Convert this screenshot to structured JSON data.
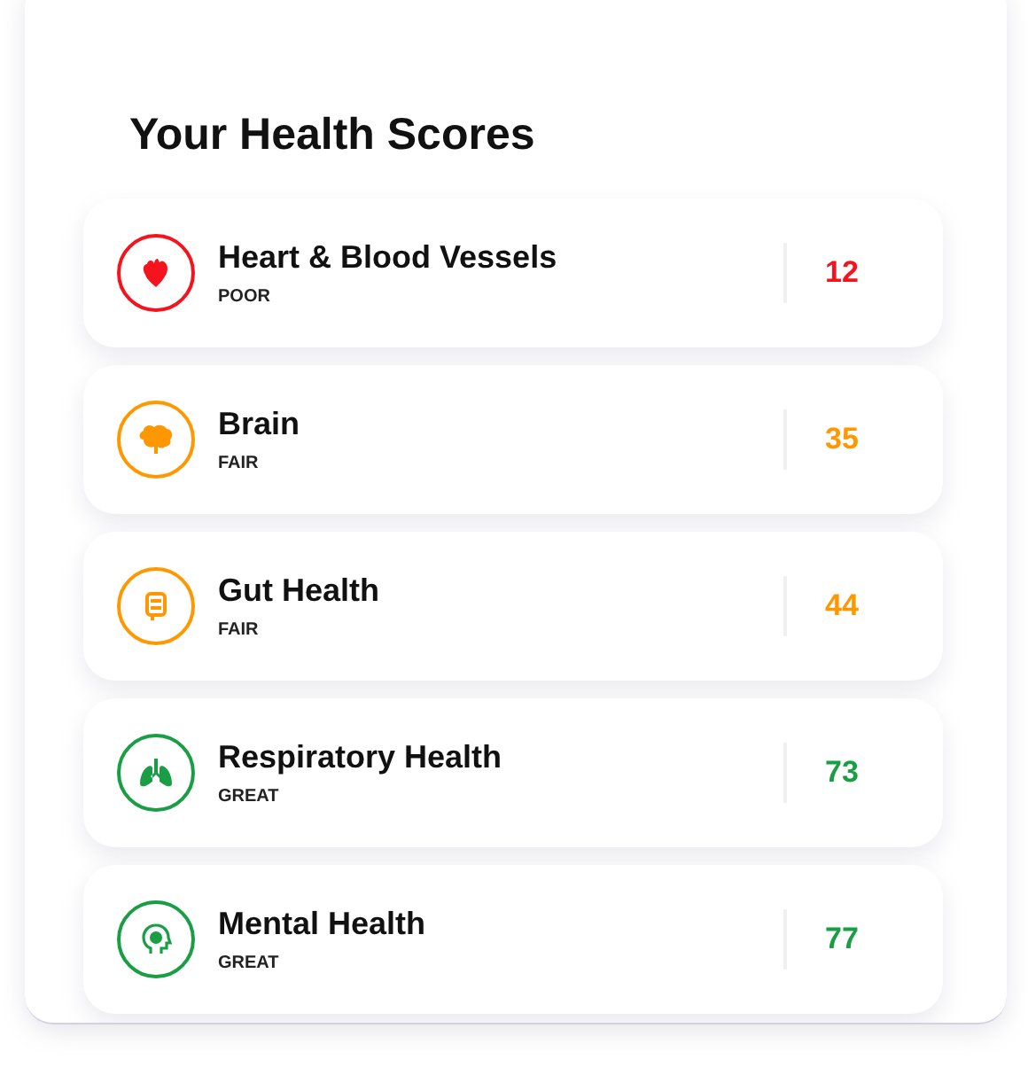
{
  "title": "Your Health Scores",
  "scores": [
    {
      "name": "Heart & Blood Vessels",
      "rating": "POOR",
      "score": "12",
      "color": "#f5141e"
    },
    {
      "name": "Brain",
      "rating": "FAIR",
      "score": "35",
      "color": "#ff9800"
    },
    {
      "name": "Gut Health",
      "rating": "FAIR",
      "score": "44",
      "color": "#ff9800"
    },
    {
      "name": "Respiratory Health",
      "rating": "GREAT",
      "score": "73",
      "color": "#1a9e45"
    },
    {
      "name": "Mental Health",
      "rating": "GREAT",
      "score": "77",
      "color": "#1a9e45"
    }
  ]
}
